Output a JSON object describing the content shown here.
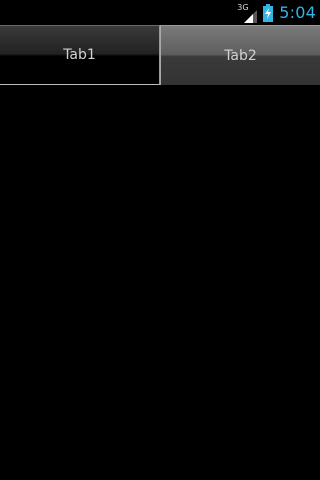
{
  "status_bar": {
    "network_label": "3G",
    "time": "5:04",
    "clock_color": "#33b5e5",
    "icons": [
      "signal-icon",
      "battery-charging-icon"
    ]
  },
  "tabs": [
    {
      "label": "Tab1",
      "selected": false
    },
    {
      "label": "Tab2",
      "selected": true
    }
  ]
}
